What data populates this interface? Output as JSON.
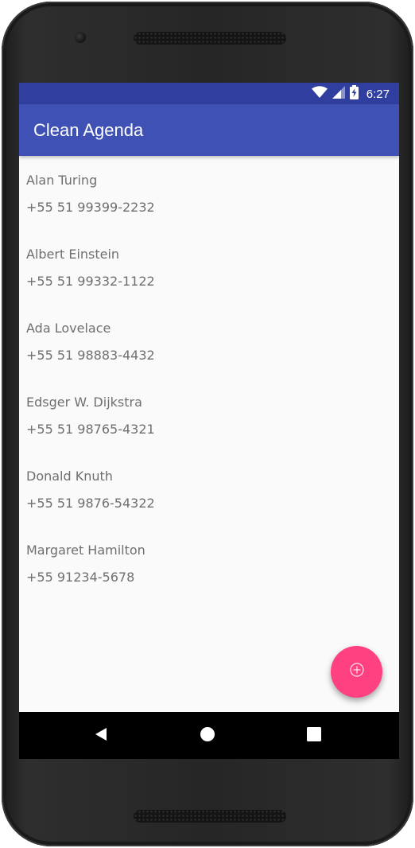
{
  "status_bar": {
    "time": "6:27",
    "icons": [
      "wifi-icon",
      "cell-signal-icon",
      "battery-charging-icon"
    ]
  },
  "app_bar": {
    "title": "Clean Agenda"
  },
  "contacts": [
    {
      "name": "Alan Turing",
      "phone": "+55 51 99399-2232"
    },
    {
      "name": "Albert Einstein",
      "phone": "+55 51 99332-1122"
    },
    {
      "name": "Ada Lovelace",
      "phone": "+55 51 98883-4432"
    },
    {
      "name": "Edsger W. Dijkstra",
      "phone": "+55 51 98765-4321"
    },
    {
      "name": "Donald Knuth",
      "phone": "+55 51 9876-54322"
    },
    {
      "name": "Margaret Hamilton",
      "phone": "+55 91234-5678"
    }
  ],
  "fab": {
    "icon": "add-circle-icon"
  },
  "nav_bar": {
    "icons": [
      "back-icon",
      "home-icon",
      "recents-icon"
    ]
  },
  "colors": {
    "status_bar": "#303f9f",
    "primary": "#3f51b5",
    "accent": "#ff4081",
    "background": "#fafafa",
    "text_secondary": "#6f6f6f"
  }
}
